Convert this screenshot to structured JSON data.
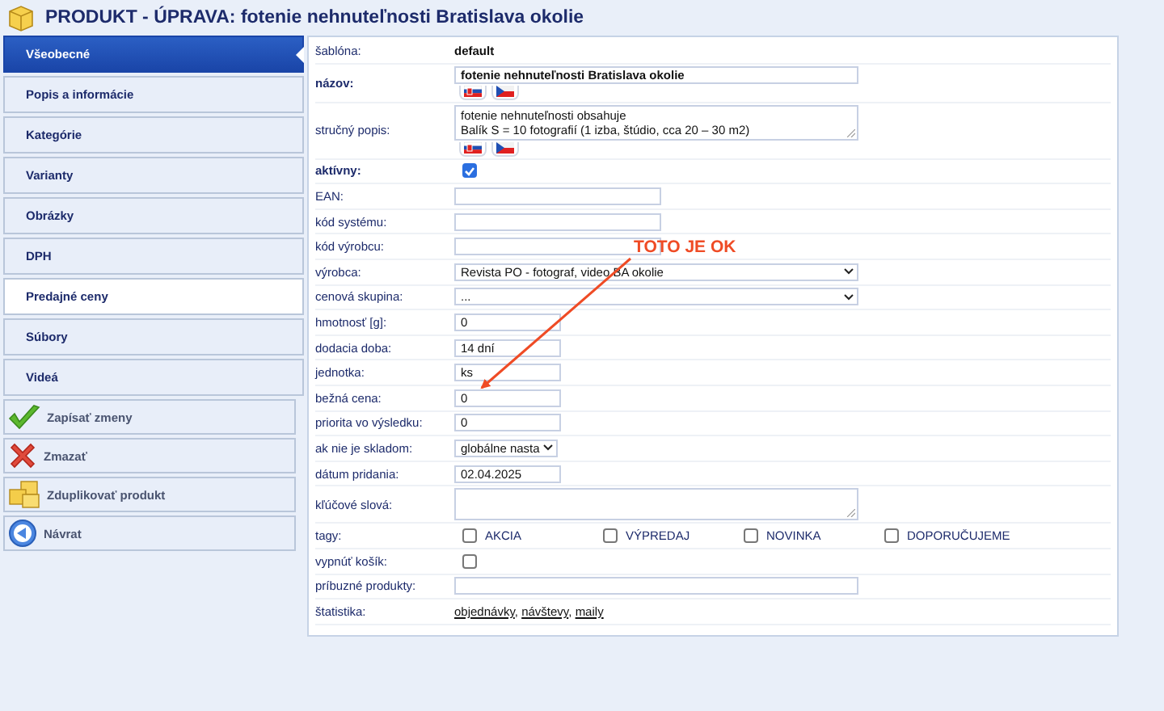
{
  "header": {
    "title": "PRODUKT - ÚPRAVA: fotenie nehnuteľnosti Bratislava okolie"
  },
  "sidebar": {
    "tabs": [
      {
        "label": "Všeobecné",
        "selected": true,
        "hovered": false
      },
      {
        "label": "Popis a informácie",
        "selected": false,
        "hovered": false
      },
      {
        "label": "Kategórie",
        "selected": false,
        "hovered": false
      },
      {
        "label": "Varianty",
        "selected": false,
        "hovered": false
      },
      {
        "label": "Obrázky",
        "selected": false,
        "hovered": false
      },
      {
        "label": "DPH",
        "selected": false,
        "hovered": false
      },
      {
        "label": "Predajné ceny",
        "selected": false,
        "hovered": true
      },
      {
        "label": "Súbory",
        "selected": false,
        "hovered": false
      },
      {
        "label": "Videá",
        "selected": false,
        "hovered": false
      }
    ],
    "actions": [
      {
        "label": "Zapísať zmeny",
        "kind": "save"
      },
      {
        "label": "Zmazať",
        "kind": "delete"
      },
      {
        "label": "Zduplikovať produkt",
        "kind": "duplicate"
      },
      {
        "label": "Návrat",
        "kind": "back"
      }
    ]
  },
  "form": {
    "rows": [
      {
        "label": "šablóna:",
        "kind": "text",
        "value": "default",
        "bold": false
      },
      {
        "label": "názov:",
        "kind": "wideinput",
        "value": "fotenie nehnuteľnosti Bratislava okolie",
        "bold": true,
        "language_flags": true
      },
      {
        "label": "stručný popis:",
        "kind": "textarea",
        "value": "fotenie nehnuteľnosti obsahuje\nBalík S = 10 fotografií (1 izba, štúdio, cca 20 – 30 m2)",
        "bold": false,
        "language_flags": true
      },
      {
        "label": "aktívny:",
        "kind": "checkbox",
        "checked": true,
        "bold": true
      },
      {
        "label": "EAN:",
        "kind": "input",
        "value": "",
        "bold": false
      },
      {
        "label": "kód systému:",
        "kind": "input",
        "value": "",
        "bold": false
      },
      {
        "label": "kód výrobcu:",
        "kind": "input",
        "value": "",
        "bold": false
      },
      {
        "label": "výrobca:",
        "kind": "wideselect",
        "value": "Revista PO - fotograf, video BA okolie",
        "bold": false
      },
      {
        "label": "cenová skupina:",
        "kind": "wideselect",
        "value": "...",
        "bold": false
      },
      {
        "label": "hmotnosť [g]:",
        "kind": "shortinput",
        "value": "0",
        "bold": false
      },
      {
        "label": "dodacia doba:",
        "kind": "shortinput",
        "value": "14 dní",
        "bold": false
      },
      {
        "label": "jednotka:",
        "kind": "shortinput",
        "value": "ks",
        "bold": false
      },
      {
        "label": "bežná cena:",
        "kind": "shortinput",
        "value": "0",
        "bold": false
      },
      {
        "label": "priorita vo výsledku:",
        "kind": "shortinput",
        "value": "0",
        "bold": false
      },
      {
        "label": "ak nie je skladom:",
        "kind": "shortselect",
        "value": "globálne nasta",
        "bold": false
      },
      {
        "label": "dátum pridania:",
        "kind": "shortinput",
        "value": "02.04.2025",
        "bold": false
      },
      {
        "label": "kľúčové slová:",
        "kind": "textarea",
        "value": "",
        "bold": false
      },
      {
        "label": "tagy:",
        "kind": "tags",
        "bold": false,
        "tags": [
          {
            "label": "AKCIA",
            "checked": false
          },
          {
            "label": "VÝPREDAJ",
            "checked": false
          },
          {
            "label": "NOVINKA",
            "checked": false
          },
          {
            "label": "DOPORUČUJEME",
            "checked": false
          }
        ]
      },
      {
        "label": "vypnúť košík:",
        "kind": "checkbox",
        "checked": false,
        "bold": false
      },
      {
        "label": "príbuzné produkty:",
        "kind": "wideinput",
        "value": "",
        "bold": false
      },
      {
        "label": "štatistika:",
        "kind": "links",
        "bold": false,
        "links": [
          {
            "label": "objednávky",
            "suffix": ","
          },
          {
            "label": "návštevy",
            "suffix": ","
          },
          {
            "label": "maily"
          }
        ]
      }
    ]
  },
  "annotation": {
    "text": "TOTO JE OK"
  }
}
